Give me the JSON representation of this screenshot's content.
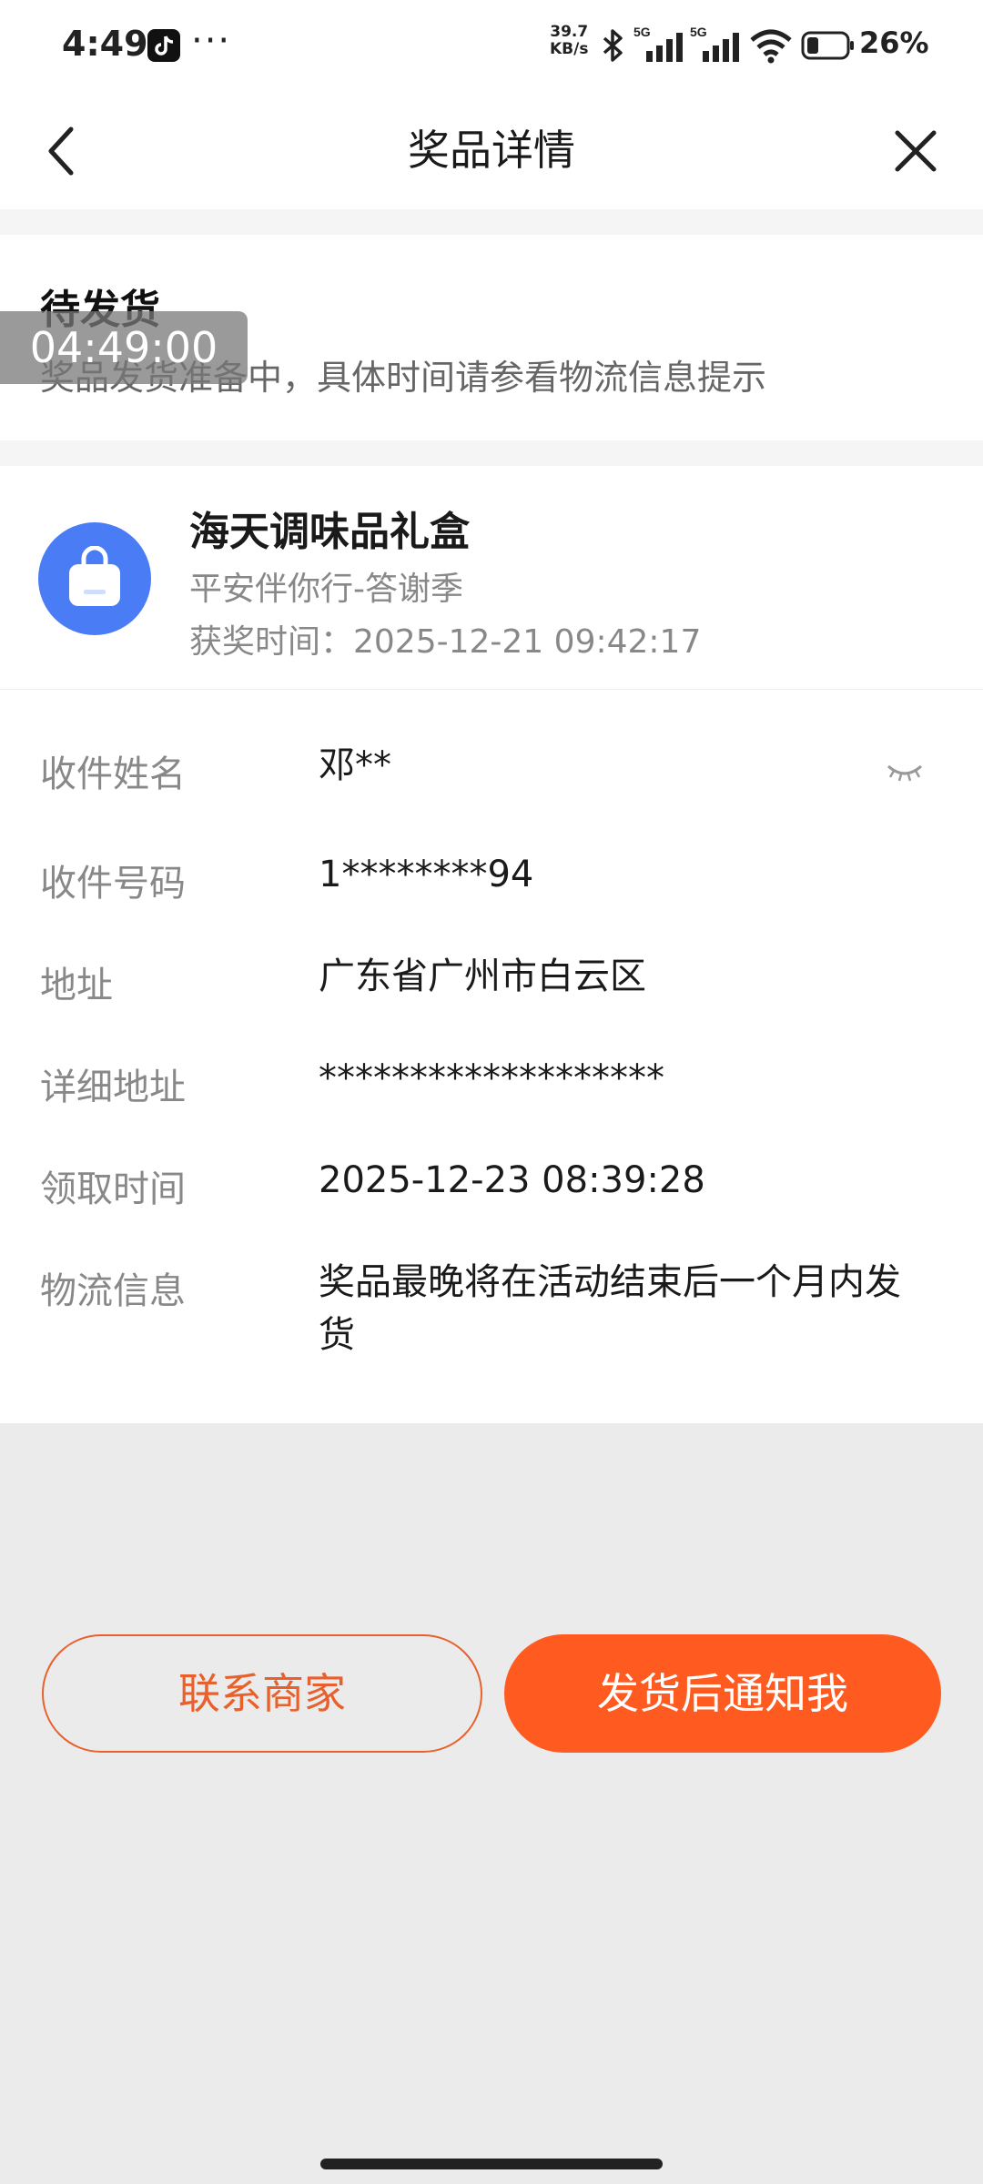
{
  "status_bar": {
    "time": "4:49",
    "more": "···",
    "net_speed_value": "39.7",
    "net_speed_unit": "KB/s",
    "battery": "26%"
  },
  "nav": {
    "title": "奖品详情"
  },
  "order_status": {
    "title": "待发货",
    "description": "奖品发货准备中，具体时间请参看物流信息提示"
  },
  "timer_overlay": "04:49:00",
  "prize": {
    "name": "海天调味品礼盒",
    "activity": "平安伴你行-答谢季",
    "win_time": "获奖时间：2025-12-21 09:42:17"
  },
  "recipient_info": [
    {
      "label": "收件姓名",
      "value": "邓**"
    },
    {
      "label": "收件号码",
      "value": "1********94"
    },
    {
      "label": "地址",
      "value": "广东省广州市白云区"
    },
    {
      "label": "详细地址",
      "value": "*******************"
    },
    {
      "label": "领取时间",
      "value": "2025-12-23 08:39:28"
    },
    {
      "label": "物流信息",
      "value": "奖品最晚将在活动结束后一个月内发货"
    }
  ],
  "buttons": {
    "contact": "联系商家",
    "notify": "发货后通知我"
  },
  "colors": {
    "accent": "#ff5a1f",
    "prize_icon_bg": "#4a7cf5"
  }
}
